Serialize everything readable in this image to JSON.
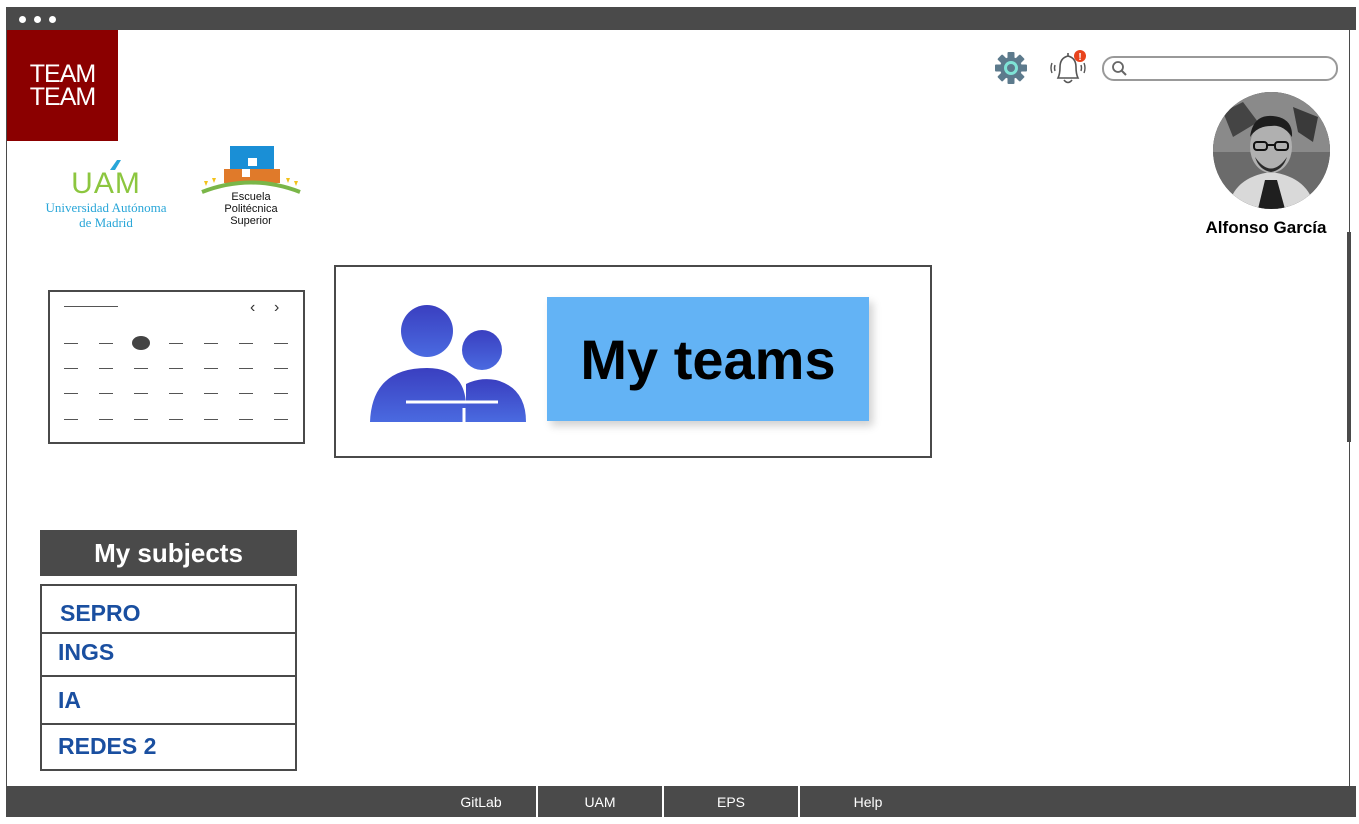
{
  "brand": {
    "logo_line1": "TEAM",
    "logo_line2": "TEAM",
    "logo_color": "#8b0000"
  },
  "partners": {
    "uam_mark": "UAM",
    "uam_line1": "Universidad Autónoma",
    "uam_line2": "de Madrid",
    "eps_line1": "Escuela",
    "eps_line2": "Politécnica",
    "eps_line3": "Superior"
  },
  "header": {
    "settings_icon": "gear-icon",
    "notifications_icon": "bell-icon",
    "notification_badge": "!",
    "search_placeholder": "",
    "search_value": ""
  },
  "user": {
    "name": "Alfonso García"
  },
  "teams_card": {
    "label": "My teams",
    "icon": "people-icon",
    "accent": "#63b3f5"
  },
  "subjects": {
    "title": "My subjects",
    "items": [
      {
        "label": "SEPRO"
      },
      {
        "label": "INGS"
      },
      {
        "label": "IA"
      },
      {
        "label": "REDES 2"
      }
    ]
  },
  "footer": {
    "links": [
      "GitLab",
      "UAM",
      "EPS",
      "Help"
    ]
  },
  "colors": {
    "frame": "#4a4a4a",
    "subject_text": "#1a4fa0",
    "icon_blue": "#3b5bd6"
  }
}
